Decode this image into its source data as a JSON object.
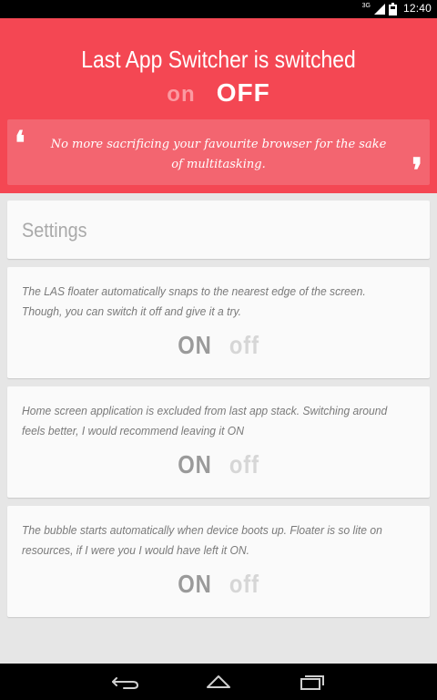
{
  "status_bar": {
    "time": "12:40",
    "network_label": "3G",
    "icons": [
      "signal-icon",
      "battery-icon"
    ]
  },
  "header": {
    "title": "Last App Switcher is switched",
    "on_label": "on",
    "off_label": "OFF",
    "quote": "No more sacrificing your favourite browser for the sake of multitasking.",
    "quote_open": "❛",
    "quote_close": "❜"
  },
  "settings": {
    "title": "Settings",
    "options": [
      {
        "description": "The LAS floater automatically snaps to the nearest edge of the screen. Though, you can switch it off and give it a try.",
        "on_label": "ON",
        "off_label": "off"
      },
      {
        "description": "Home screen application is excluded from last app stack. Switching around feels better, I would recommend leaving it ON",
        "on_label": "ON",
        "off_label": "off"
      },
      {
        "description": "The bubble starts automatically when device boots up. Floater is so lite on resources, if I were you I would have left it ON.",
        "on_label": "ON",
        "off_label": "off"
      }
    ]
  },
  "nav_bar": {
    "buttons": [
      "back-icon",
      "home-icon",
      "recent-apps-icon"
    ]
  },
  "colors": {
    "accent": "#f44753",
    "quote_box": "#f36570",
    "background": "#e6e6e6",
    "card": "#fafafa"
  }
}
